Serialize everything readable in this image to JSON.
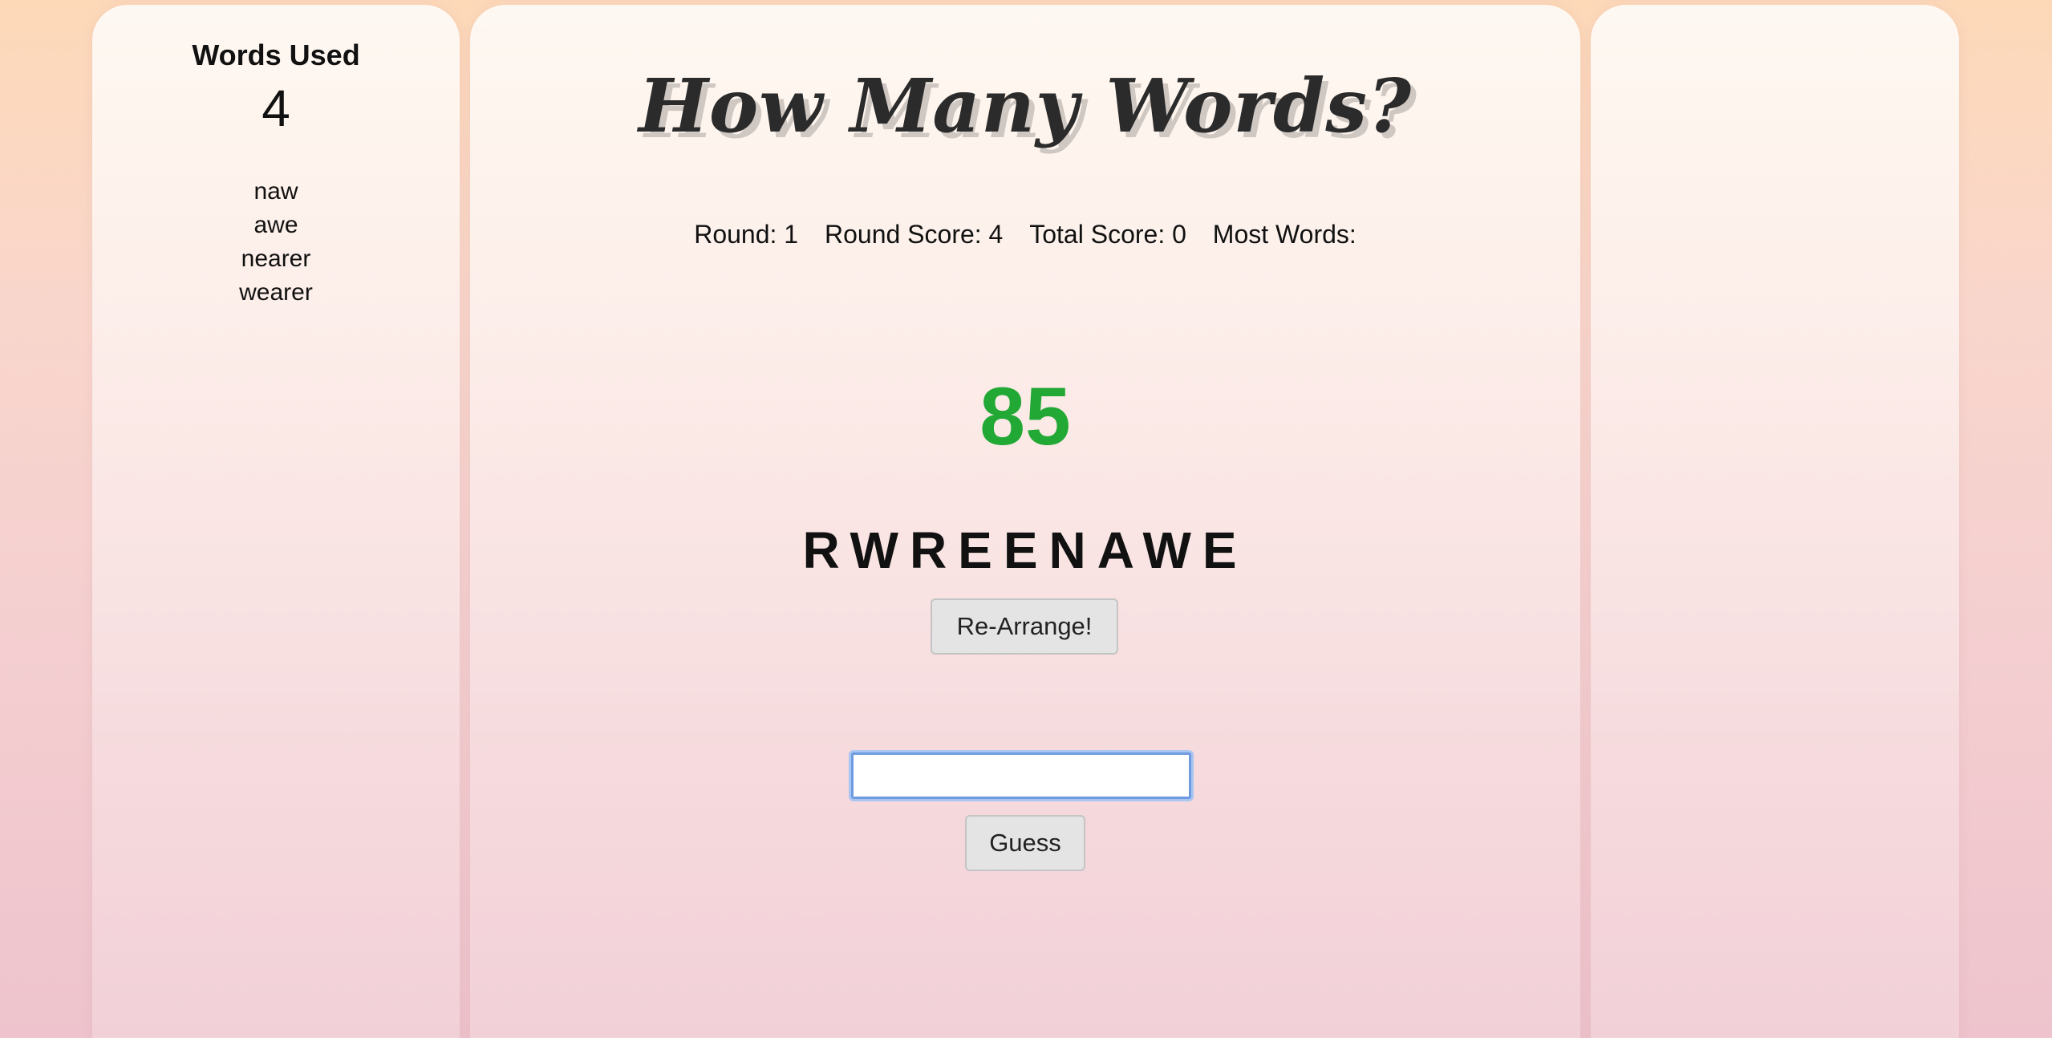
{
  "sidebar": {
    "title": "Words Used",
    "count": "4",
    "words": [
      "naw",
      "awe",
      "nearer",
      "wearer"
    ]
  },
  "main": {
    "title": "How Many Words?",
    "stats": {
      "round": "Round: 1",
      "round_score": "Round Score: 4",
      "total_score": "Total Score: 0",
      "most_words": "Most Words:"
    },
    "timer": "85",
    "letters": "RWREENAWE",
    "rearrange_label": "Re-Arrange!",
    "guess_input_value": "",
    "guess_label": "Guess"
  },
  "colors": {
    "timer": "#22a834",
    "input_focus": "#6f9be0"
  }
}
